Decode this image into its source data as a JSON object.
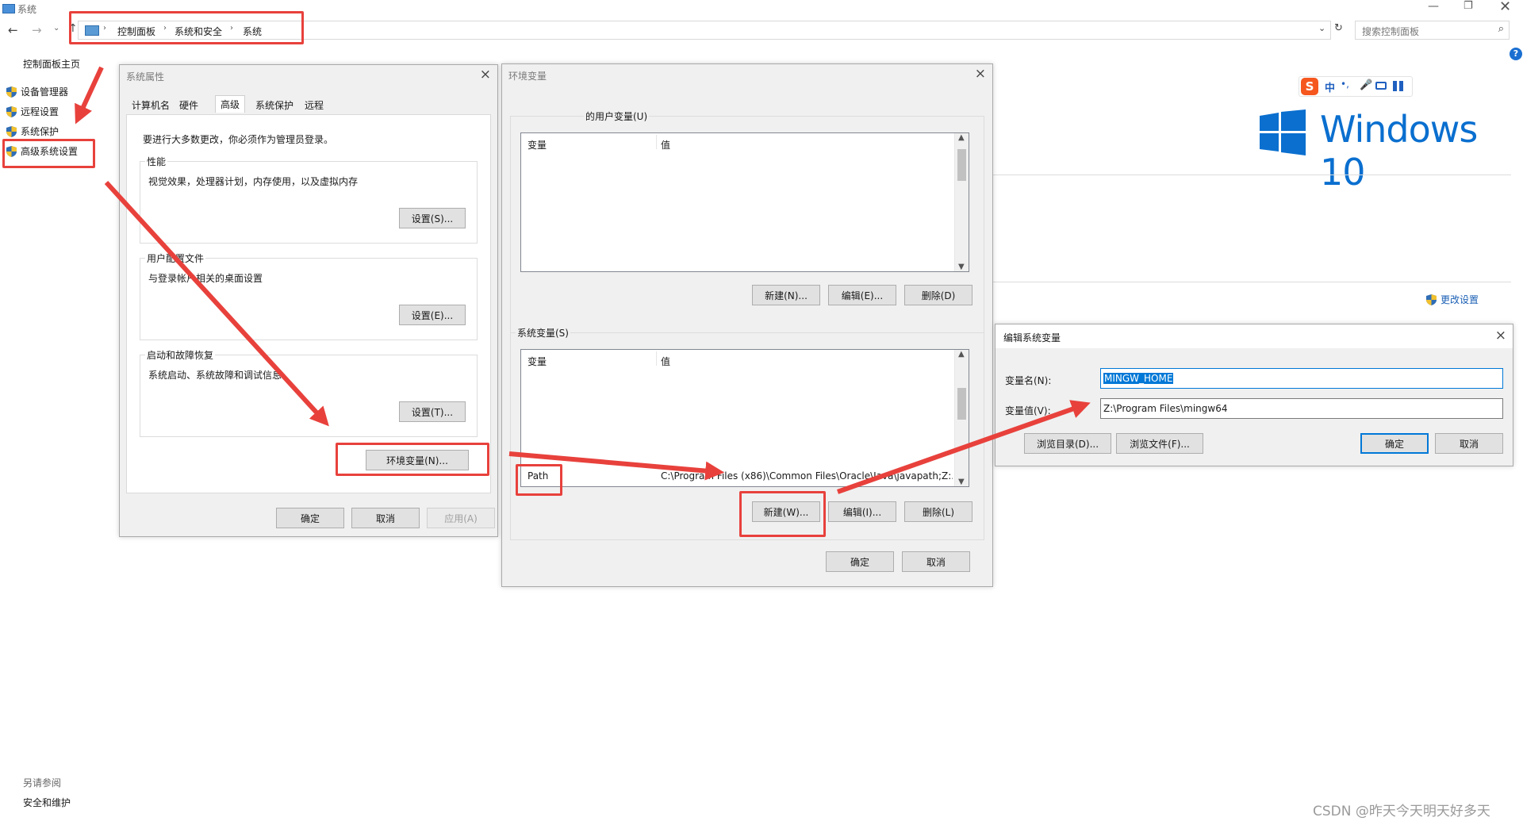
{
  "window": {
    "title": "系统"
  },
  "address": {
    "crumbs": [
      "控制面板",
      "系统和安全",
      "系统"
    ],
    "search_placeholder": "搜索控制面板"
  },
  "sidebar": {
    "home": "控制面板主页",
    "items": [
      {
        "label": "设备管理器"
      },
      {
        "label": "远程设置"
      },
      {
        "label": "系统保护"
      },
      {
        "label": "高级系统设置"
      }
    ],
    "see_also_title": "另请参阅",
    "see_also_items": [
      "安全和维护"
    ]
  },
  "ime_bar": {
    "mode": "中",
    "punct": "•,"
  },
  "branding": {
    "windows": "Windows 10",
    "change_settings": "更改设置"
  },
  "watermark": "CSDN @昨天今天明天好多天",
  "sys_props": {
    "title": "系统属性",
    "tabs": [
      "计算机名",
      "硬件",
      "高级",
      "系统保护",
      "远程"
    ],
    "notice": "要进行大多数更改，你必须作为管理员登录。",
    "perf": {
      "label": "性能",
      "desc": "视觉效果，处理器计划，内存使用，以及虚拟内存",
      "button": "设置(S)..."
    },
    "profile": {
      "label": "用户配置文件",
      "desc": "与登录帐户相关的桌面设置",
      "button": "设置(E)..."
    },
    "startup": {
      "label": "启动和故障恢复",
      "desc": "系统启动、系统故障和调试信息",
      "button": "设置(T)..."
    },
    "env_button": "环境变量(N)...",
    "ok": "确定",
    "cancel": "取消",
    "apply": "应用(A)"
  },
  "env_vars": {
    "title": "环境变量",
    "user_label": "的用户变量(U)",
    "col_var": "变量",
    "col_val": "值",
    "user_buttons": {
      "new": "新建(N)...",
      "edit": "编辑(E)...",
      "delete": "删除(D)"
    },
    "sys_label": "系统变量(S)",
    "sys_rows": [
      {
        "name": "Path",
        "value": "C:\\Program Files (x86)\\Common Files\\Oracle\\Java\\javapath;Z:..."
      }
    ],
    "sys_buttons": {
      "new": "新建(W)...",
      "edit": "编辑(I)...",
      "delete": "删除(L)"
    },
    "ok": "确定",
    "cancel": "取消"
  },
  "edit_var": {
    "title": "编辑系统变量",
    "name_label": "变量名(N):",
    "name_value": "MINGW_HOME",
    "value_label": "变量值(V):",
    "value_value": "Z:\\Program Files\\mingw64",
    "browse_dir": "浏览目录(D)...",
    "browse_file": "浏览文件(F)...",
    "ok": "确定",
    "cancel": "取消"
  },
  "colors": {
    "annotation_red": "#e8413c",
    "accent_blue": "#0078d7",
    "windows_blue": "#0a6fcf",
    "sogou_orange": "#f5571f"
  }
}
